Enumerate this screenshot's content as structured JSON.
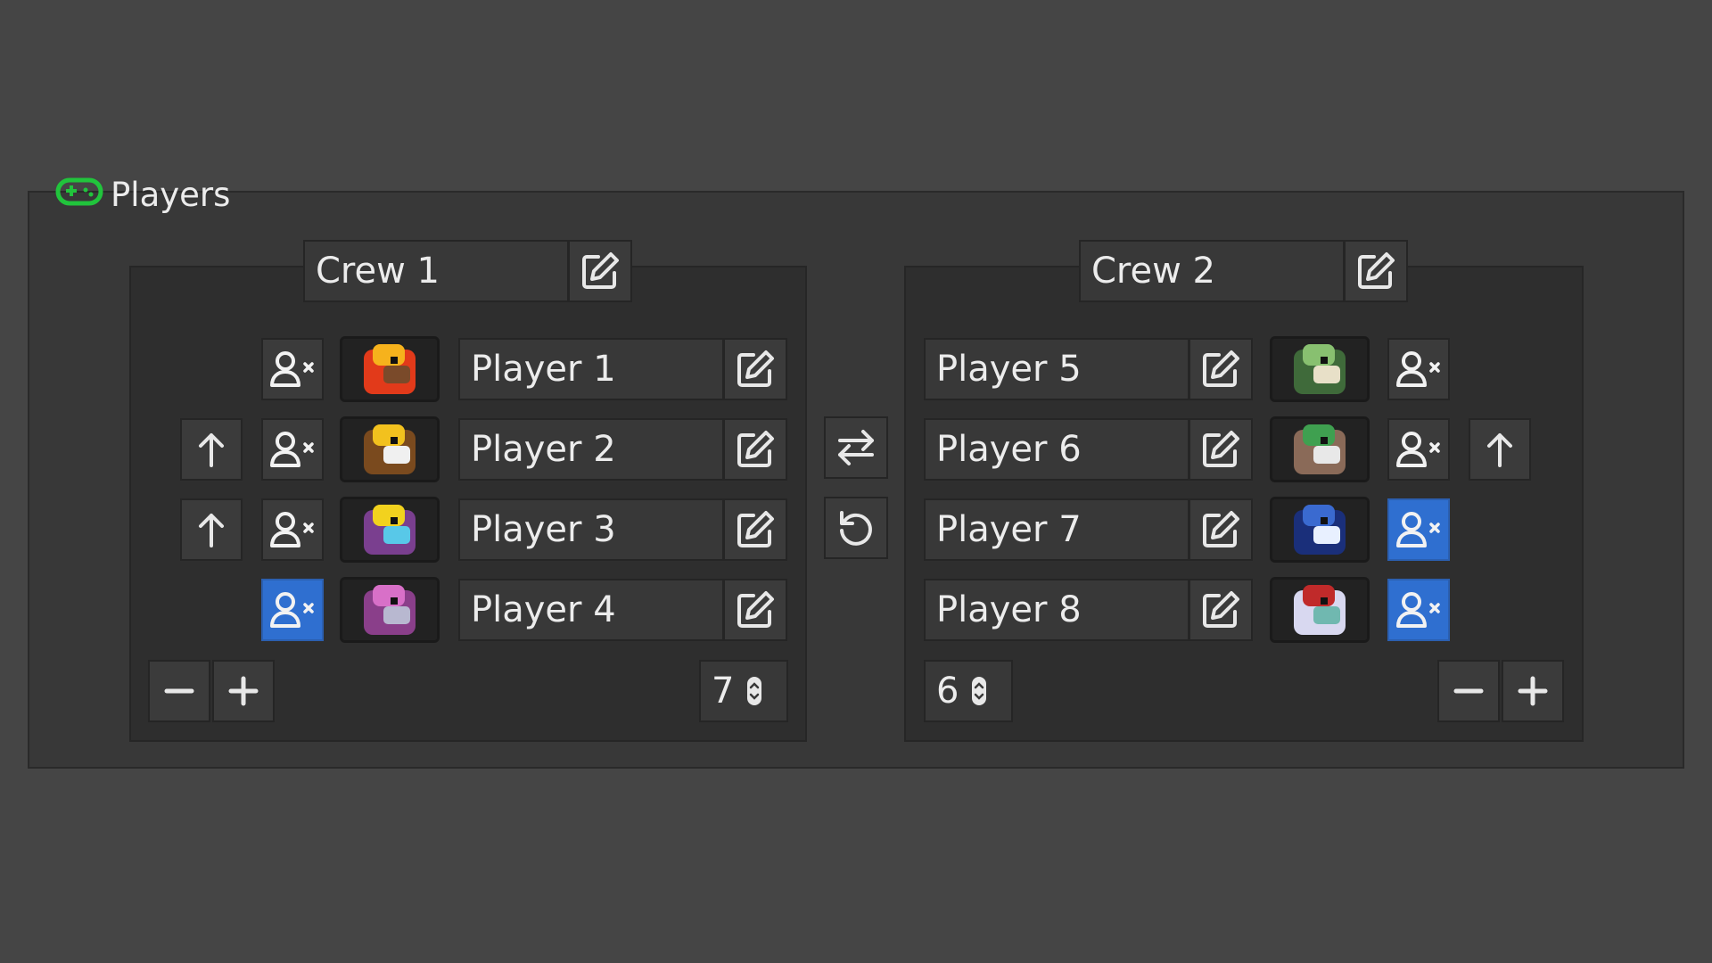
{
  "panel": {
    "title": "Players",
    "icon": "gamepad-icon",
    "accent": "#21c43c"
  },
  "crew1": {
    "name": "Crew 1",
    "count": "7",
    "players": [
      {
        "name": "Player 1",
        "remove_active": false,
        "has_up": false,
        "avatar": "lion"
      },
      {
        "name": "Player 2",
        "remove_active": false,
        "has_up": true,
        "avatar": "beast"
      },
      {
        "name": "Player 3",
        "remove_active": false,
        "has_up": true,
        "avatar": "bird"
      },
      {
        "name": "Player 4",
        "remove_active": true,
        "has_up": false,
        "avatar": "imp"
      }
    ]
  },
  "crew2": {
    "name": "Crew 2",
    "count": "6",
    "players": [
      {
        "name": "Player 5",
        "remove_active": false,
        "has_up": false,
        "avatar": "frog"
      },
      {
        "name": "Player 6",
        "remove_active": false,
        "has_up": true,
        "avatar": "ram"
      },
      {
        "name": "Player 7",
        "remove_active": true,
        "has_up": false,
        "avatar": "orca"
      },
      {
        "name": "Player 8",
        "remove_active": true,
        "has_up": false,
        "avatar": "bear"
      }
    ]
  },
  "icons": {
    "swap": "swap-icon",
    "reset": "reset-icon",
    "edit": "edit-icon",
    "remove_user": "user-remove-icon",
    "move_up": "arrow-up-icon",
    "minus": "minus-icon",
    "plus": "plus-icon"
  },
  "colors": {
    "active_button": "#2f6fd0",
    "background": "#454545"
  }
}
